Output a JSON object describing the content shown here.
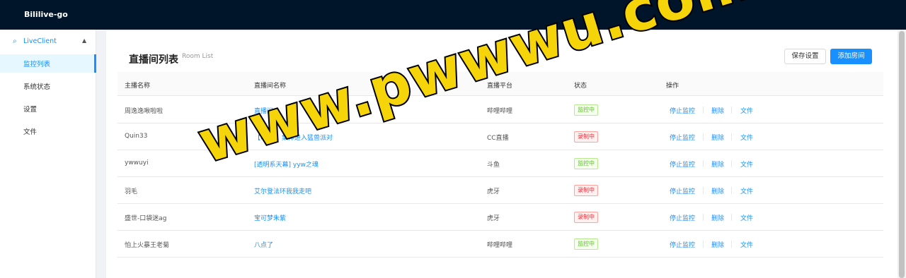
{
  "app": {
    "title": "Bililive-go"
  },
  "sidebar": {
    "group_label": "LiveClient",
    "items": [
      {
        "label": "监控列表"
      },
      {
        "label": "系统状态"
      },
      {
        "label": "设置"
      },
      {
        "label": "文件"
      }
    ]
  },
  "page": {
    "title": "直播间列表",
    "subtitle": "Room List",
    "save_button": "保存设置",
    "add_button": "添加房间"
  },
  "table": {
    "headers": [
      "主播名称",
      "直播间名称",
      "直播平台",
      "状态",
      "操作"
    ],
    "rows": [
      {
        "host": "周逸逸啾啦啦",
        "room": "直播间",
        "platform": "哔哩哔哩",
        "status": "监控中",
        "status_type": "ok"
      },
      {
        "host": "Quin33",
        "room": "【Quin】集体进入猛兽派对",
        "platform": "CC直播",
        "status": "录制中",
        "status_type": "rec"
      },
      {
        "host": "ywwuyi",
        "room": "[透明系天幕] yyw之魂",
        "platform": "斗鱼",
        "status": "监控中",
        "status_type": "ok"
      },
      {
        "host": "羽毛",
        "room": "艾尔登法环我我走吧",
        "platform": "虎牙",
        "status": "录制中",
        "status_type": "rec"
      },
      {
        "host": "盛世-口袋迷ag",
        "room": "宝可梦朱紫",
        "platform": "虎牙",
        "status": "录制中",
        "status_type": "rec"
      },
      {
        "host": "怕上火暴王老菊",
        "room": "八点了",
        "platform": "哔哩哔哩",
        "status": "监控中",
        "status_type": "ok"
      }
    ],
    "actions": {
      "stop": "停止监控",
      "delete": "删除",
      "files": "文件"
    }
  },
  "watermark": {
    "text": "www.pwwwu.com"
  },
  "colors": {
    "header": "#001529",
    "accent": "#1890ff",
    "ok": "#52c41a",
    "rec": "#f5222d",
    "watermark": "#f5d50a"
  }
}
